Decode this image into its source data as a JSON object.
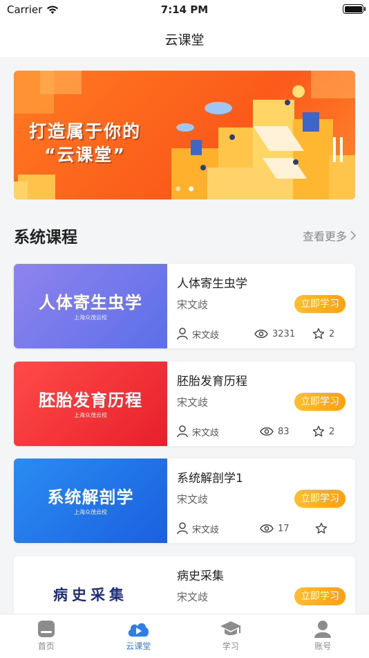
{
  "status_bar": {
    "carrier": "Carrier",
    "time": "7:14 PM"
  },
  "nav": {
    "title": "云课堂"
  },
  "banner": {
    "line1": "打造属于你的",
    "line2": "“云课堂”",
    "active_index": 1
  },
  "section": {
    "title": "系统课程",
    "more": "查看更多"
  },
  "courses": [
    {
      "thumb_title": "人体寄生虫学",
      "thumb_sub": "上海众茂云校",
      "name": "人体寄生虫学",
      "teacher": "宋文歧",
      "action": "立即学习",
      "author": "宋文歧",
      "views": "3231",
      "stars": "2",
      "thumb_colors": [
        "#8f83ee",
        "#5b6fe8"
      ]
    },
    {
      "thumb_title": "胚胎发育历程",
      "thumb_sub": "上海众茂云校",
      "name": "胚胎发育历程",
      "teacher": "宋文歧",
      "action": "立即学习",
      "author": "宋文歧",
      "views": "83",
      "stars": "2",
      "thumb_colors": [
        "#ff4b48",
        "#e81f2b"
      ]
    },
    {
      "thumb_title": "系统解剖学",
      "thumb_sub": "上海众茂云校",
      "name": "系统解剖学1",
      "teacher": "宋文歧",
      "action": "立即学习",
      "author": "宋文歧",
      "views": "17",
      "stars": "",
      "thumb_colors": [
        "#2a8cf2",
        "#1b60df"
      ]
    },
    {
      "thumb_title": "病史采集",
      "thumb_sub": "",
      "name": "病史采集",
      "teacher": "宋文歧",
      "action": "立即学习",
      "author": "",
      "views": "",
      "stars": "",
      "thumb_colors": [
        "#ffffff",
        "#ffffff"
      ]
    }
  ],
  "tabbar": {
    "items": [
      {
        "label": "首页",
        "icon": "home-icon"
      },
      {
        "label": "云课堂",
        "icon": "cloud-play-icon"
      },
      {
        "label": "学习",
        "icon": "graduation-cap-icon"
      },
      {
        "label": "账号",
        "icon": "user-icon"
      }
    ],
    "active_index": 1,
    "active_color": "#2f7de6",
    "inactive_color": "#888888"
  },
  "accent_color": "#ffa516"
}
